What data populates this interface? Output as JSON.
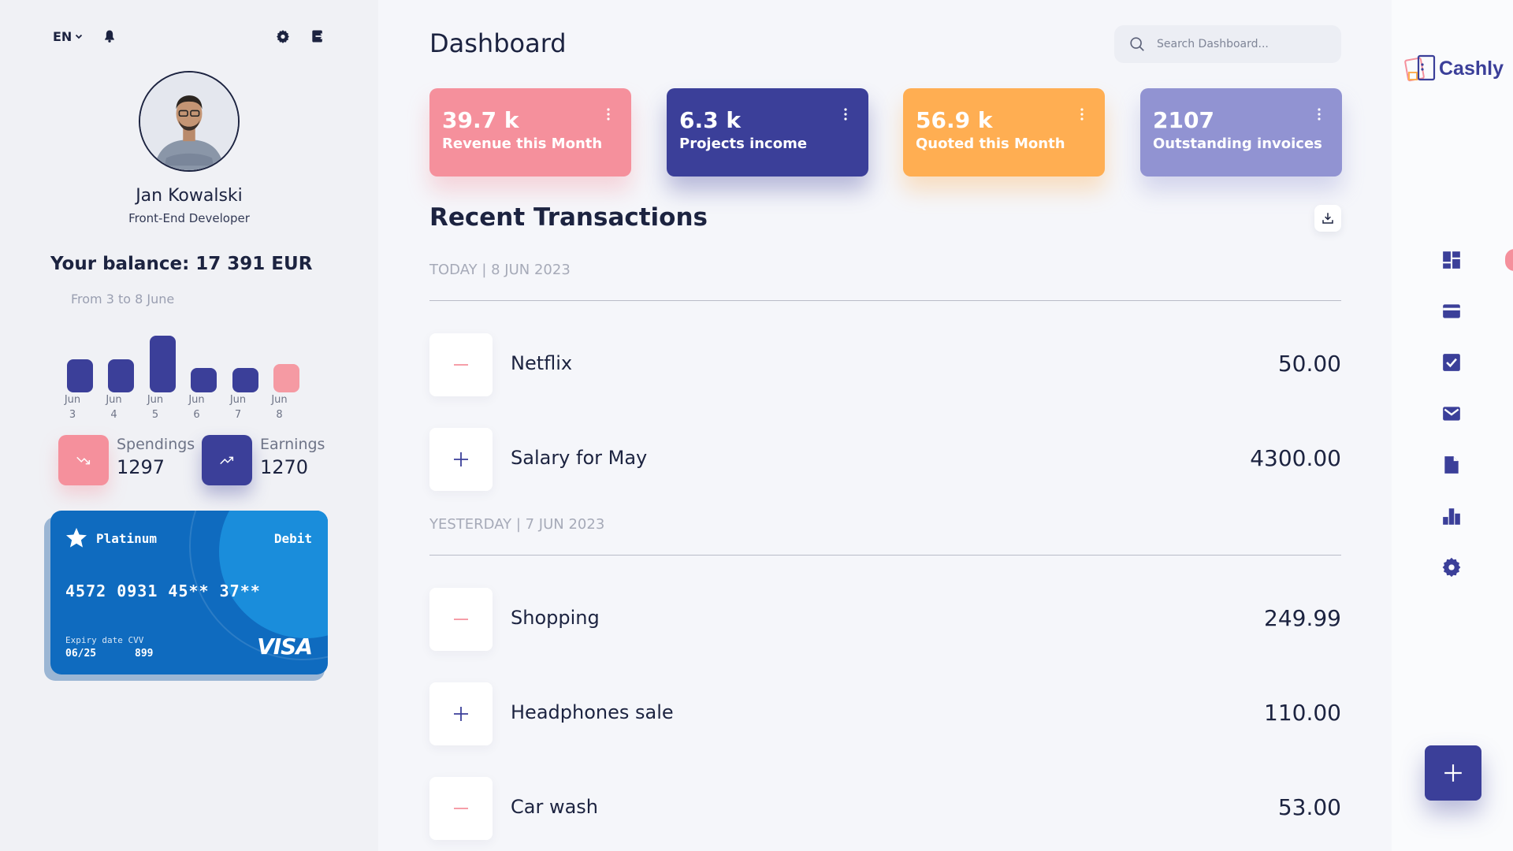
{
  "header": {
    "language": "EN",
    "icons": {
      "language_caret": "chevron-down-icon",
      "notifications": "bell-icon",
      "settings": "gear-icon",
      "logout": "logout-icon"
    }
  },
  "profile": {
    "name": "Jan Kowalski",
    "role": "Front-End Developer",
    "balance": "Your balance: 17 391 EUR",
    "range": "From 3 to 8 June"
  },
  "balance_chart": {
    "type": "bar",
    "categories": [
      "Jun 3",
      "Jun 4",
      "Jun 5",
      "Jun 6",
      "Jun 7",
      "Jun 8"
    ],
    "label_lines": [
      [
        "Jun",
        "3"
      ],
      [
        "Jun",
        "4"
      ],
      [
        "Jun",
        "5"
      ],
      [
        "Jun",
        "6"
      ],
      [
        "Jun",
        "7"
      ],
      [
        "Jun",
        "8"
      ]
    ],
    "values": [
      40,
      40,
      68,
      29,
      29,
      34
    ],
    "highlight_index": 5,
    "colors": {
      "bar": "#3b3f99",
      "highlight": "#f59aa3"
    }
  },
  "stats": {
    "spendings": {
      "label": "Spendings",
      "value": "1297",
      "icon": "trending-down-icon"
    },
    "earnings": {
      "label": "Earnings",
      "value": "1270",
      "icon": "trending-up-icon"
    }
  },
  "card": {
    "tier": "Platinum",
    "type": "Debit",
    "number": "4572 0931 45** 37**",
    "expiry_label": "Expiry date",
    "cvv_label": "CVV",
    "expiry": "06/25",
    "cvv": "899",
    "brand": "VISA",
    "icon": "star-icon",
    "color": "#0f6bbf"
  },
  "main": {
    "title": "Dashboard",
    "search_placeholder": "Search Dashboard...",
    "kpis": [
      {
        "value": "39.7 k",
        "label": "Revenue this Month",
        "color": "#f5909c"
      },
      {
        "value": "6.3 k",
        "label": "Projects income",
        "color": "#3b3f99"
      },
      {
        "value": "56.9 k",
        "label": "Quoted this Month",
        "color": "#ffae52"
      },
      {
        "value": "2107",
        "label": "Outstanding invoices",
        "color": "#9193d2"
      }
    ],
    "section_title": "Recent Transactions",
    "groups": [
      {
        "date": "TODAY | 8 JUN 2023",
        "transactions": [
          {
            "kind": "expense",
            "name": "Netflix",
            "amount": "50.00"
          },
          {
            "kind": "income",
            "name": "Salary for May",
            "amount": "4300.00"
          }
        ]
      },
      {
        "date": "YESTERDAY | 7 JUN 2023",
        "transactions": [
          {
            "kind": "expense",
            "name": "Shopping",
            "amount": "249.99"
          },
          {
            "kind": "income",
            "name": "Headphones sale",
            "amount": "110.00"
          },
          {
            "kind": "expense",
            "name": "Car wash",
            "amount": "53.00"
          }
        ]
      }
    ]
  },
  "sidebar": {
    "logo_text": "Cashly",
    "items": [
      "dashboard-icon",
      "wallet-icon",
      "checkbox-icon",
      "mail-icon",
      "document-icon",
      "bar-chart-icon",
      "gear-icon"
    ],
    "fab_icon": "plus-icon",
    "accent": "#3b3f99"
  }
}
